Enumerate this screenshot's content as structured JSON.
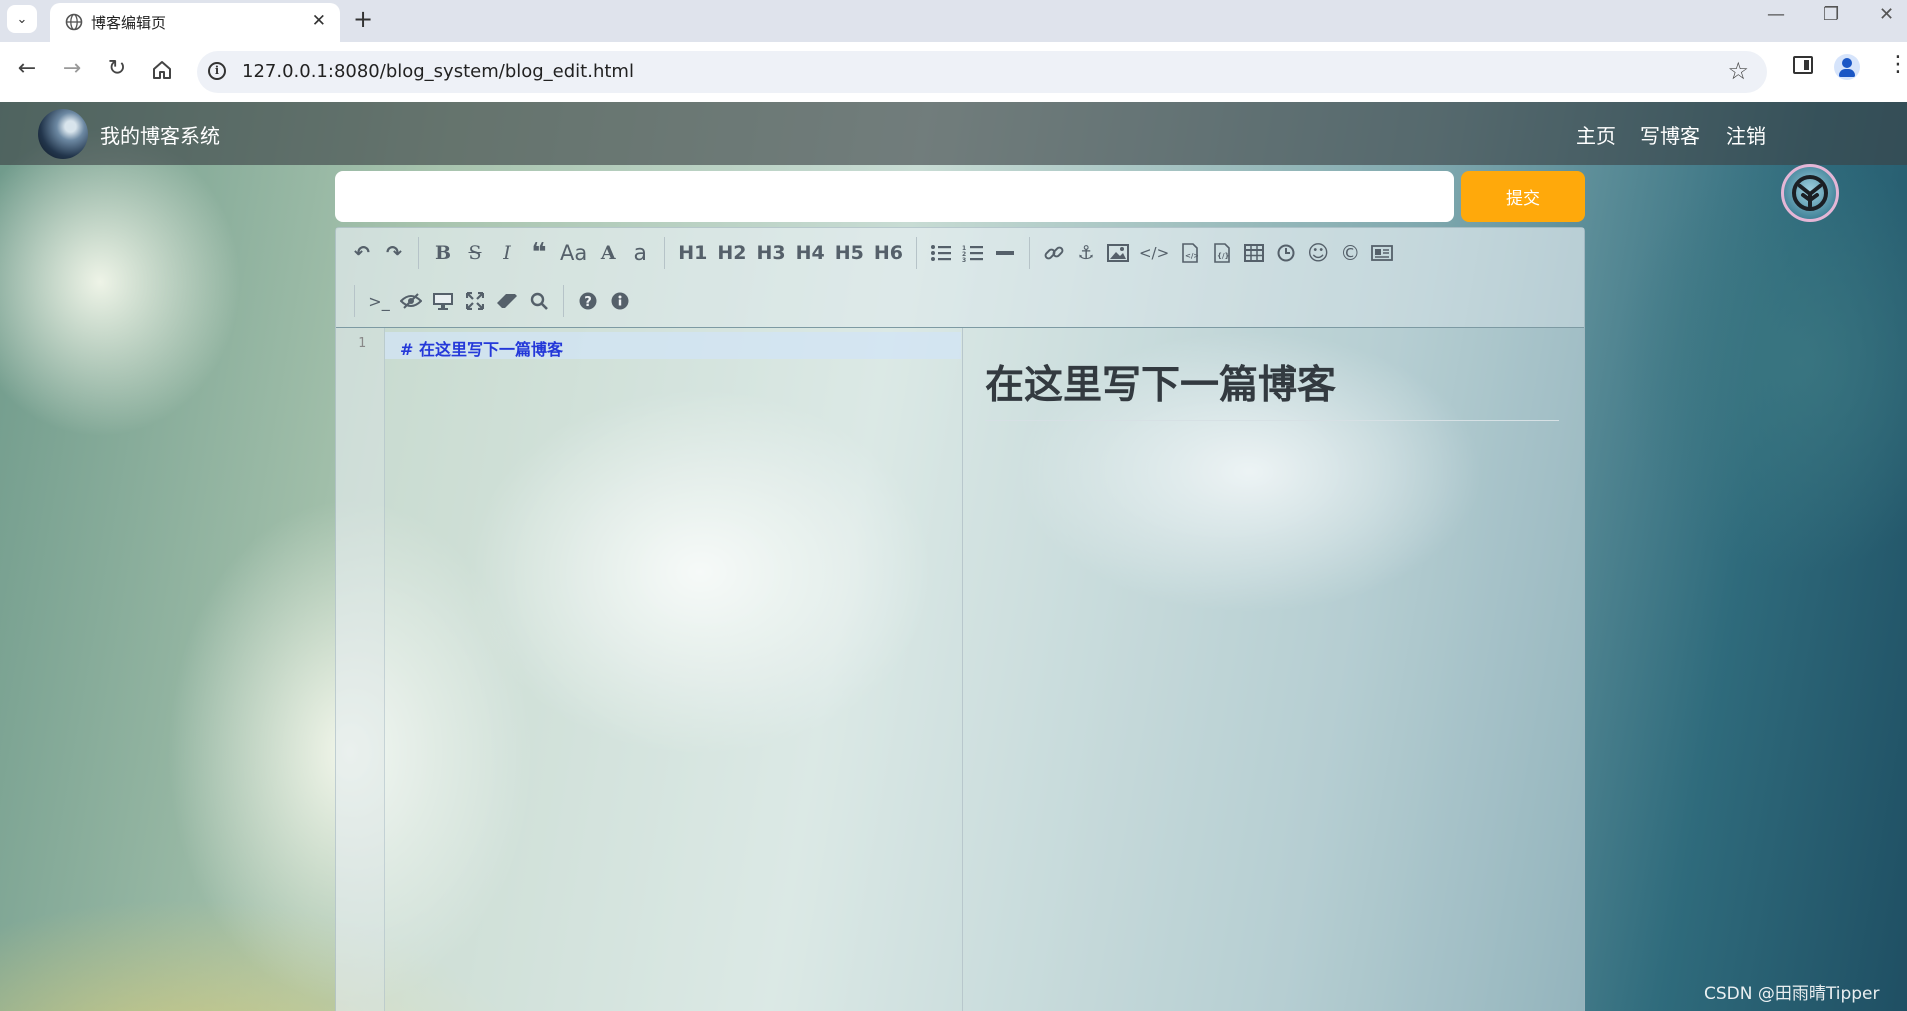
{
  "browser": {
    "tab_title": "博客编辑页",
    "url": "127.0.0.1:8080/blog_system/blog_edit.html"
  },
  "navbar": {
    "site_title": "我的博客系统",
    "links": [
      "主页",
      "写博客",
      "注销"
    ]
  },
  "editor_form": {
    "title_value": "",
    "submit_label": "提交"
  },
  "editor": {
    "toolbar_row1": [
      "undo",
      "redo",
      "bold",
      "strikethrough",
      "italic",
      "quote",
      "uppercase",
      "Aa",
      "A",
      "a",
      "H1",
      "H2",
      "H3",
      "H4",
      "H5",
      "H6",
      "unordered-list",
      "ordered-list",
      "hr",
      "link",
      "anchor",
      "image",
      "code",
      "preformatted-text",
      "code-block",
      "table",
      "datetime",
      "emoji",
      "html-entities",
      "pagebreak"
    ],
    "toolbar_row2": [
      "goto-line",
      "watch",
      "preview",
      "fullscreen",
      "clear",
      "search",
      "help",
      "info"
    ],
    "line_number": "1",
    "markdown": "# 在这里写下一篇博客",
    "preview_heading": "在这里写下一篇博客"
  },
  "watermark": "CSDN @田雨晴Tipper",
  "colors": {
    "submit": "#ffa90b",
    "navbar": "rgba(60,66,70,.62)",
    "code_text": "#2438d9"
  }
}
